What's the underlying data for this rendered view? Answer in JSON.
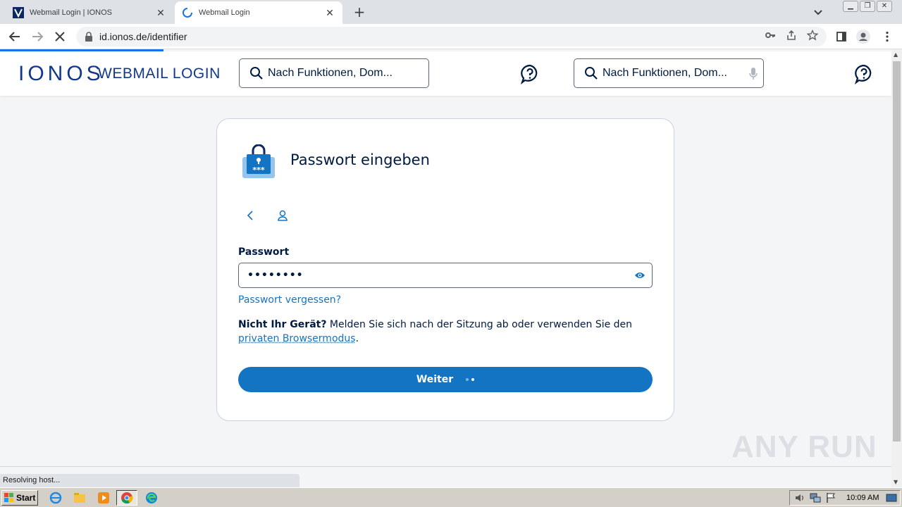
{
  "browser": {
    "tabs": [
      {
        "title": "Webmail Login | IONOS",
        "active": false
      },
      {
        "title": "Webmail Login",
        "active": true
      }
    ],
    "new_tab_label": "+",
    "url": "id.ionos.de/identifier",
    "status": "Resolving host..."
  },
  "header": {
    "brand": "IONOS",
    "product": "WEBMAIL LOGIN",
    "search_placeholder_1": "Nach Funktionen, Dom...",
    "search_placeholder_2": "Nach Funktionen, Dom..."
  },
  "card": {
    "title": "Passwort eingeben",
    "password_label": "Passwort",
    "password_value": "••••••••",
    "forgot_link": "Passwort vergessen?",
    "hint_bold": "Nicht Ihr Gerät?",
    "hint_text": " Melden Sie sich nach der Sitzung ab oder verwenden Sie den ",
    "hint_link": "privaten Browsermodus",
    "hint_end": ".",
    "submit_label": "Weiter"
  },
  "watermark": "ANY RUN",
  "taskbar": {
    "start_label": "Start",
    "clock": "10:09 AM"
  },
  "colors": {
    "primary": "#1474c4",
    "brand": "#11388c",
    "text": "#001b41",
    "background": "#f3f5f7"
  }
}
